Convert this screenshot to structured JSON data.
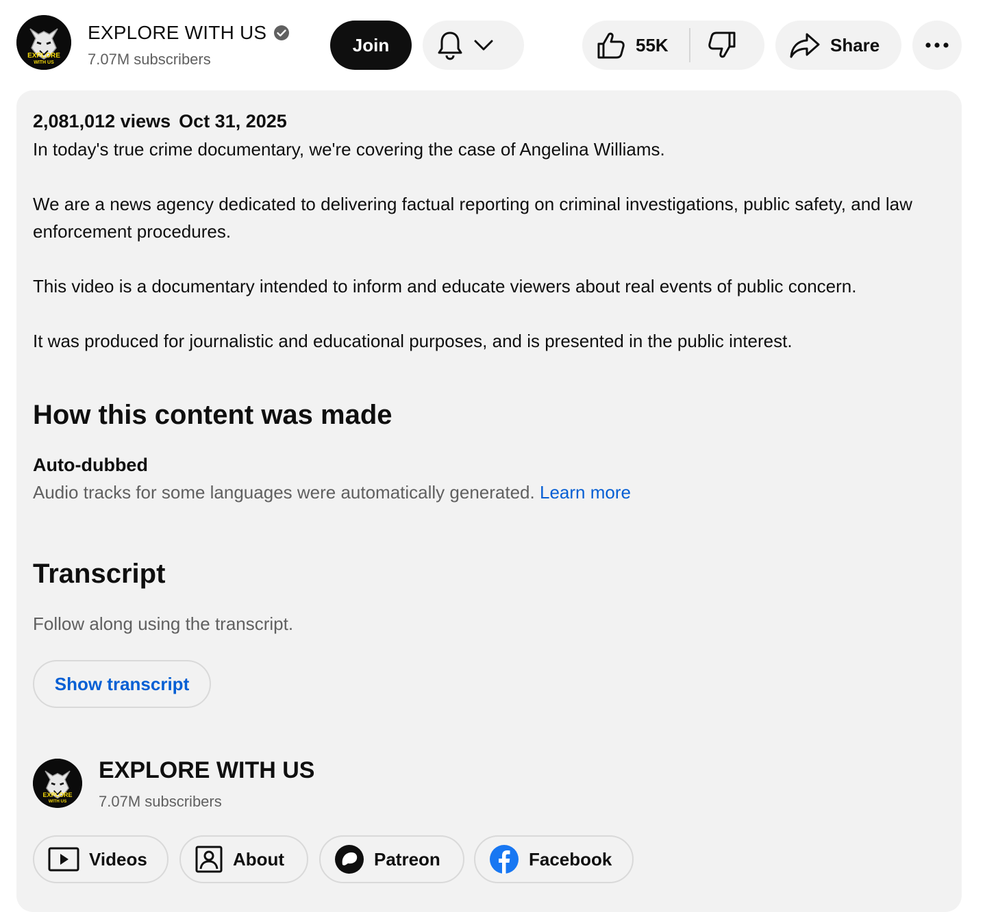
{
  "header": {
    "channel_name": "EXPLORE WITH US",
    "subscribers": "7.07M subscribers",
    "join_label": "Join",
    "like_count": "55K",
    "share_label": "Share",
    "avatar_logo_line1": "EXPLORE",
    "avatar_logo_line2": "WITH US"
  },
  "description": {
    "views": "2,081,012 views",
    "date": "Oct 31, 2025",
    "paragraphs": [
      "In today's true crime documentary, we're covering the case of Angelina Williams.",
      "We are a news agency dedicated to delivering factual reporting on criminal investigations, public safety, and law enforcement procedures.",
      "This video is a documentary intended to inform and educate viewers about real events of public concern.",
      "It was produced for journalistic and educational purposes, and is presented in the public interest."
    ]
  },
  "how_made": {
    "title": "How this content was made",
    "label": "Auto-dubbed",
    "text": "Audio tracks for some languages were automatically generated.",
    "link": "Learn more"
  },
  "transcript": {
    "title": "Transcript",
    "text": "Follow along using the transcript.",
    "button": "Show transcript"
  },
  "footer": {
    "channel_name": "EXPLORE WITH US",
    "subscribers": "7.07M subscribers",
    "chips": [
      {
        "label": "Videos",
        "icon": "video-play-icon"
      },
      {
        "label": "About",
        "icon": "person-box-icon"
      },
      {
        "label": "Patreon",
        "icon": "patreon-icon"
      },
      {
        "label": "Facebook",
        "icon": "facebook-icon"
      }
    ]
  },
  "colors": {
    "link": "#065fd4",
    "panel": "#f2f2f2",
    "join_bg": "#0f0f0f",
    "logo_yellow": "#f5d90a",
    "facebook_blue": "#1877f2"
  }
}
